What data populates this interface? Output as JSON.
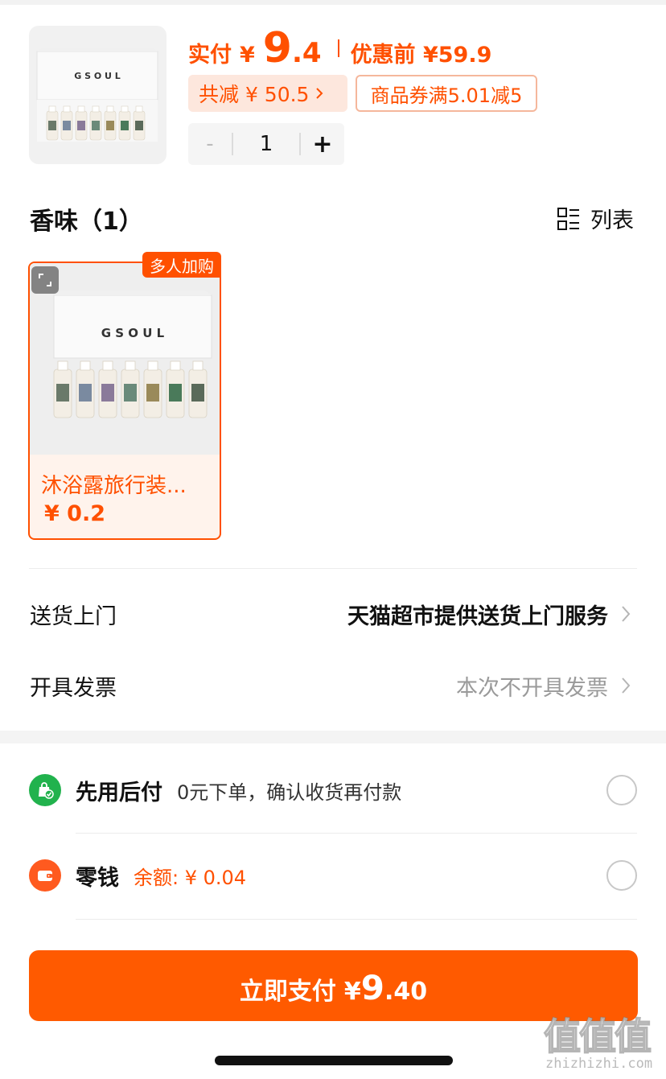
{
  "header": {
    "pay_label": "实付",
    "pay_yen": "¥",
    "pay_int": "9",
    "pay_dec": ".4",
    "original_price": "优惠前 ¥59.9",
    "discount_chip": "共减 ¥ 50.5",
    "coupon_chip": "商品券满5.01减5",
    "product_brand": "G S O U L"
  },
  "stepper": {
    "minus": "-",
    "quantity": "1",
    "plus": "+"
  },
  "scent": {
    "title": "香味（1）",
    "view_toggle": "列表",
    "variant": {
      "badge": "多人加购",
      "name": "沐浴露旅行装...",
      "price": "¥ 0.2",
      "brand": "G S O U L"
    }
  },
  "delivery": {
    "label": "送货上门",
    "value": "天猫超市提供送货上门服务"
  },
  "invoice": {
    "label": "开具发票",
    "value": "本次不开具发票"
  },
  "payment_methods": [
    {
      "title": "先用后付",
      "desc": "0元下单，确认收货再付款",
      "icon": "shopping-bag-check-icon",
      "color": "#21b24d"
    },
    {
      "title": "零钱",
      "desc": "余额: ¥ 0.04",
      "icon": "wallet-icon",
      "color": "#ff5a1f"
    }
  ],
  "pay_button": {
    "t1": "立即支付",
    "yen": "¥",
    "int": "9",
    "dec": ".40"
  },
  "watermark": {
    "main": "值值值",
    "sub": "zhizhizhi.com"
  },
  "colors": {
    "accent": "#ff5000",
    "button": "#ff5a00",
    "chip_bg": "#fde7dd",
    "green": "#21b24d"
  }
}
